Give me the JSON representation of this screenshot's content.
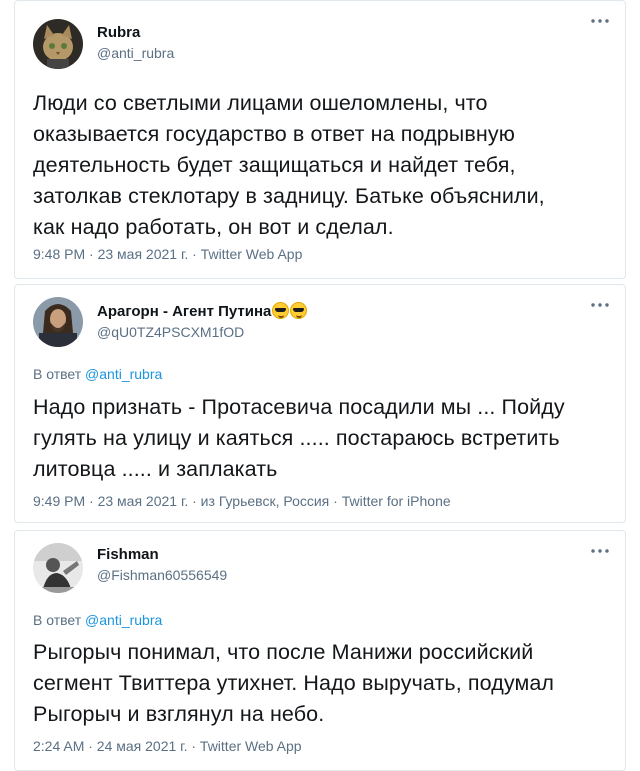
{
  "tweets": [
    {
      "author_name": "Rubra",
      "handle": "@anti_rubra",
      "text": "Люди со светлыми лицами ошеломлены, что\nоказывается государство в ответ на подрывную\nдеятельность будет защищаться и найдет тебя,\nзатолкав стеклотару в задницу. Батьке объяснили,\nкак надо работать, он вот и сделал.",
      "meta": "9:48 PM · 23 мая 2021 г. · Twitter Web App"
    },
    {
      "author_name": "Арагорн - Агент Путина",
      "name_emoji": [
        "smiling-face-with-sunglasses",
        "smiling-face-with-sunglasses"
      ],
      "handle": "@qU0TZ4PSCXM1fOD",
      "reply_prefix": "В ответ",
      "reply_to": "@anti_rubra",
      "text": "Надо признать - Протасевича посадили мы ... Пойду\nгулять на улицу и каяться ..... постараюсь встретить\nлитовца ..... и заплакать",
      "meta": "9:49 PM · 23 мая 2021 г. · из Гурьевск, Россия · Twitter for iPhone"
    },
    {
      "author_name": "Fishman",
      "handle": "@Fishman60556549",
      "reply_prefix": "В ответ",
      "reply_to": "@anti_rubra",
      "text": "Рыгорыч понимал, что после Манижи российский\nсегмент Твиттера утихнет. Надо выручать, подумал\nРыгорыч и взглянул на небо.",
      "meta": "2:24 AM · 24 мая 2021 г. · Twitter Web App"
    }
  ],
  "colors": {
    "secondary_text": "#5b7083",
    "link": "#1b95e0",
    "border": "#e1e8ed"
  }
}
